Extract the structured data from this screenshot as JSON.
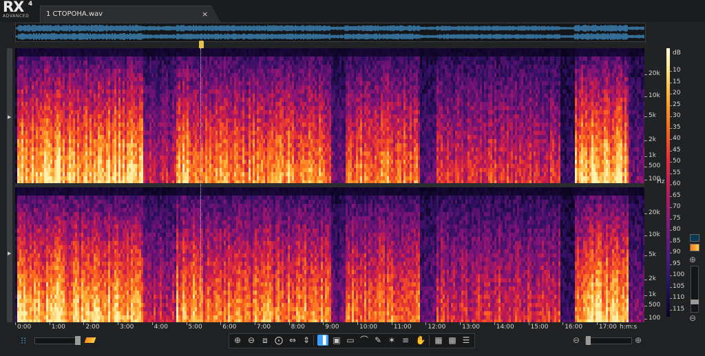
{
  "app": {
    "logo": "RX",
    "version": "4",
    "edition": "ADVANCED"
  },
  "tab": {
    "title": "1 СТОРОНА.wav",
    "close_glyph": "×"
  },
  "frequency_axis": {
    "labels": [
      "20k",
      "10k",
      "5k",
      "2k",
      "1k",
      "500",
      "100"
    ],
    "unit": "Hz"
  },
  "db_scale": {
    "unit": "dB",
    "labels": [
      "10",
      "15",
      "20",
      "25",
      "30",
      "35",
      "40",
      "45",
      "50",
      "55",
      "60",
      "65",
      "70",
      "75",
      "80",
      "85",
      "90",
      "95",
      "100",
      "105",
      "110",
      "115"
    ]
  },
  "time_axis": {
    "labels": [
      "0:00",
      "1:00",
      "2:00",
      "3:00",
      "4:00",
      "5:00",
      "6:00",
      "7:00",
      "8:00",
      "9:00",
      "10:00",
      "11:00",
      "12:00",
      "13:00",
      "14:00",
      "15:00",
      "16:00",
      "17:00"
    ],
    "unit": "h:m:s",
    "duration_minutes": 18.3,
    "playhead_minutes": 5.3
  },
  "colors": {
    "accent": "#3da0ff",
    "waveform": "#4aa8e8",
    "playhead": "#e6c24a"
  },
  "icons": {
    "waveform_view": "waveform-icon",
    "spectrogram_view": "spectrogram-icon",
    "zoom_in": "zoom-in-icon",
    "zoom_out": "zoom-out-icon",
    "tools": [
      "zoom-in-icon",
      "zoom-out-icon",
      "zoom-selection-icon",
      "zoom-fit-icon",
      "zoom-horizontal-icon",
      "zoom-vertical-icon",
      "time-select-icon",
      "time-frequency-select-icon",
      "frequency-select-icon",
      "lasso-icon",
      "brush-icon",
      "magic-wand-icon",
      "harmonic-select-icon",
      "hand-icon",
      "filter-a-icon",
      "filter-b-icon",
      "list-icon"
    ]
  }
}
